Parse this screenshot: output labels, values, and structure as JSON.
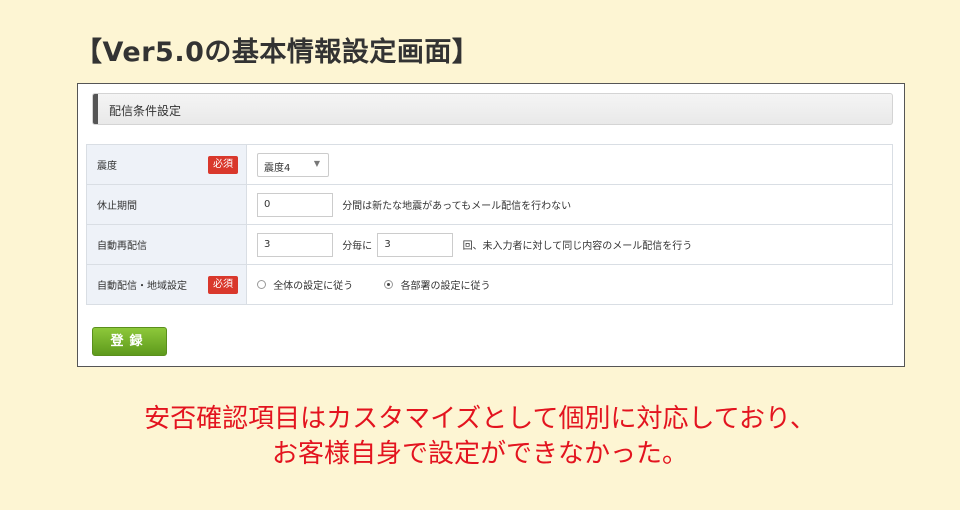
{
  "page_title": "【Ver5.0の基本情報設定画面】",
  "section": {
    "title": "配信条件設定"
  },
  "rows": {
    "intensity": {
      "label": "震度",
      "required": "必須",
      "select_value": "震度4"
    },
    "pause": {
      "label": "休止期間",
      "value": "0",
      "suffix": "分間は新たな地震があってもメール配信を行わない"
    },
    "resend": {
      "label": "自動再配信",
      "value1": "3",
      "mid": "分毎に",
      "value2": "3",
      "suffix": "回、未入力者に対して同じ内容のメール配信を行う"
    },
    "area": {
      "label": "自動配信・地域設定",
      "required": "必須",
      "option1": "全体の設定に従う",
      "option2": "各部署の設定に従う"
    }
  },
  "submit_label": "登録",
  "caption": {
    "line1": "安否確認項目はカスタマイズとして個別に対応しており、",
    "line2": "お客様自身で設定ができなかった。"
  }
}
